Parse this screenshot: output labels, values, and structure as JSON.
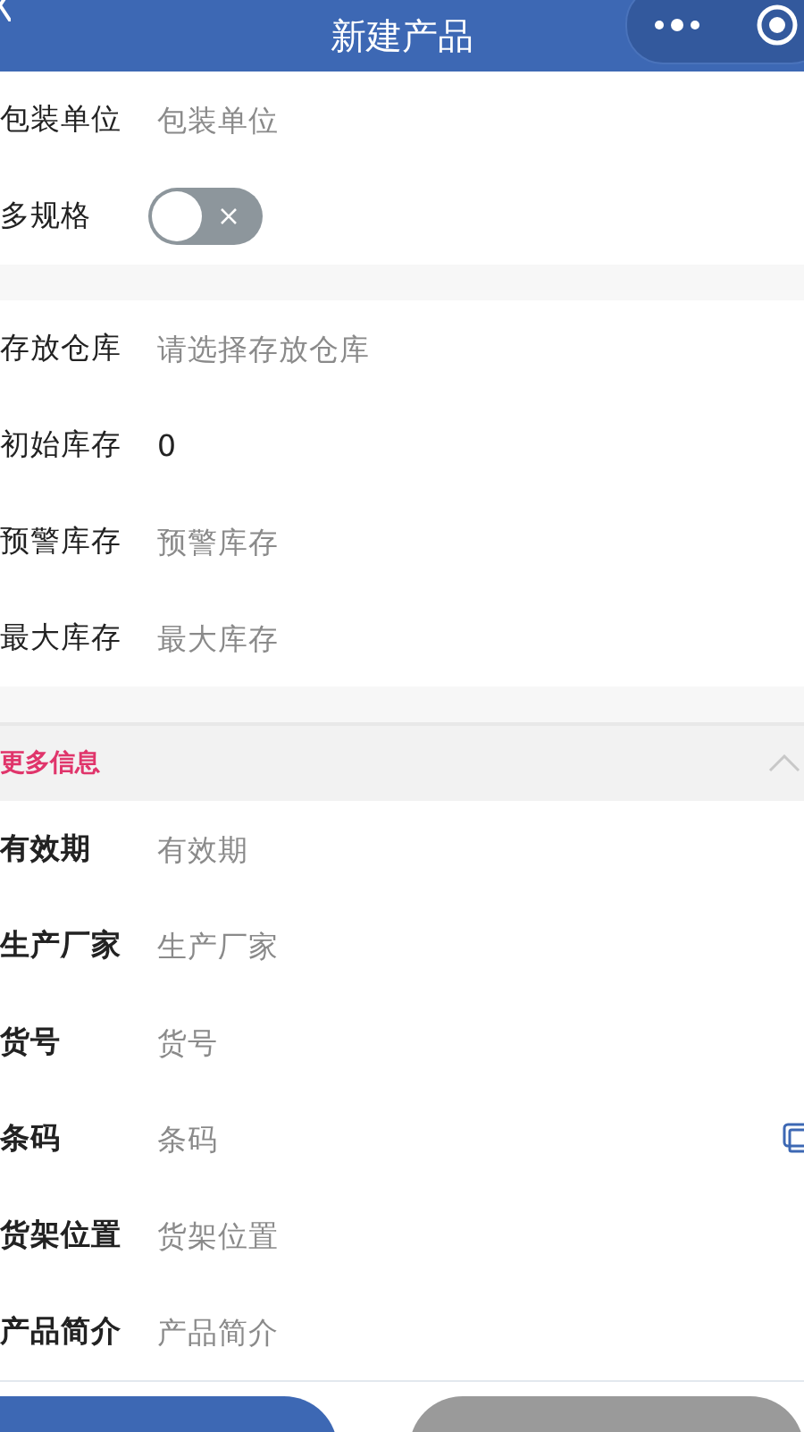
{
  "header": {
    "title": "新建产品"
  },
  "groups": [
    {
      "fields": [
        {
          "kind": "input",
          "label": "包装单位",
          "placeholder": "包装单位"
        },
        {
          "kind": "switch",
          "label": "多规格",
          "on": false
        }
      ]
    },
    {
      "fields": [
        {
          "kind": "input",
          "label": "存放仓库",
          "placeholder": "请选择存放仓库"
        },
        {
          "kind": "input",
          "label": "初始库存",
          "value": "0"
        },
        {
          "kind": "input",
          "label": "预警库存",
          "placeholder": "预警库存"
        },
        {
          "kind": "input",
          "label": "最大库存",
          "placeholder": "最大库存"
        }
      ]
    }
  ],
  "more": {
    "title": "更多信息",
    "expanded": true,
    "fields": [
      {
        "kind": "input",
        "label": "有效期",
        "placeholder": "有效期"
      },
      {
        "kind": "input",
        "label": "生产厂家",
        "placeholder": "生产厂家"
      },
      {
        "kind": "input",
        "label": "货号",
        "placeholder": "货号"
      },
      {
        "kind": "scan",
        "label": "条码",
        "placeholder": "条码"
      },
      {
        "kind": "input",
        "label": "货架位置",
        "placeholder": "货架位置"
      },
      {
        "kind": "input",
        "label": "产品简介",
        "placeholder": "产品简介"
      }
    ]
  },
  "buttons": [
    {
      "kind": "primary"
    },
    {
      "kind": "secondary"
    }
  ]
}
